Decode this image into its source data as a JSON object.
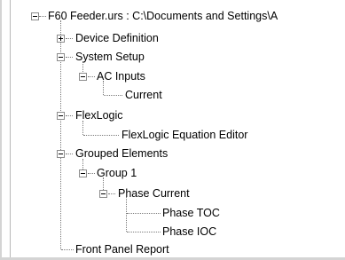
{
  "tree": {
    "root": {
      "label": "F60 Feeder.urs : C:\\Documents and Settings\\A",
      "expanded": true,
      "children": [
        {
          "label": "Device Definition",
          "expanded": false
        },
        {
          "label": "System Setup",
          "expanded": true,
          "children": [
            {
              "label": "AC Inputs",
              "expanded": true,
              "children": [
                {
                  "label": "Current"
                }
              ]
            }
          ]
        },
        {
          "label": "FlexLogic",
          "expanded": true,
          "children": [
            {
              "label": "FlexLogic Equation Editor"
            }
          ]
        },
        {
          "label": "Grouped Elements",
          "expanded": true,
          "children": [
            {
              "label": "Group 1",
              "expanded": true,
              "children": [
                {
                  "label": "Phase Current",
                  "expanded": true,
                  "children": [
                    {
                      "label": "Phase TOC"
                    },
                    {
                      "label": "Phase IOC"
                    }
                  ]
                }
              ]
            }
          ]
        },
        {
          "label": "Front Panel Report"
        }
      ]
    }
  }
}
